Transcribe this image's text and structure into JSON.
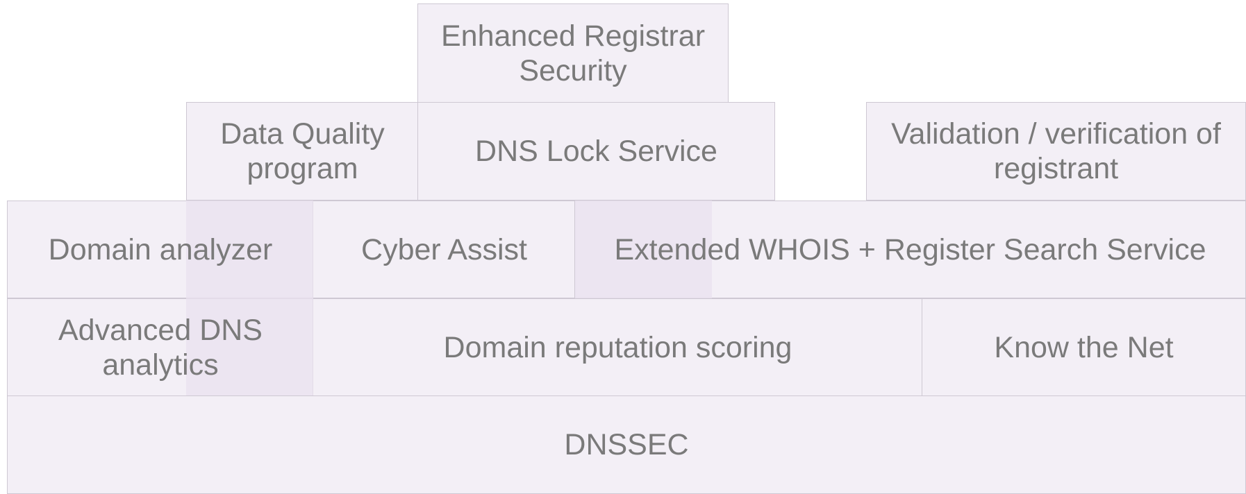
{
  "diagram": {
    "blocks": {
      "enhanced_registrar_security": "Enhanced Registrar Security",
      "data_quality_program": "Data Quality program",
      "dns_lock_service": "DNS Lock Service",
      "validation_verification": "Validation /  verification of registrant",
      "domain_analyzer": "Domain analyzer",
      "cyber_assist": "Cyber Assist",
      "extended_whois": "Extended WHOIS + Register Search Service",
      "advanced_dns_analytics": "Advanced DNS analytics",
      "domain_reputation_scoring": "Domain reputation scoring",
      "know_the_net": "Know the Net",
      "dnssec": "DNSSEC"
    },
    "colors": {
      "block_fill": "#f3eff6",
      "block_border": "#cec8d3",
      "overlap_fill": "#e9e2ef",
      "text": "#7a7a7a"
    }
  }
}
